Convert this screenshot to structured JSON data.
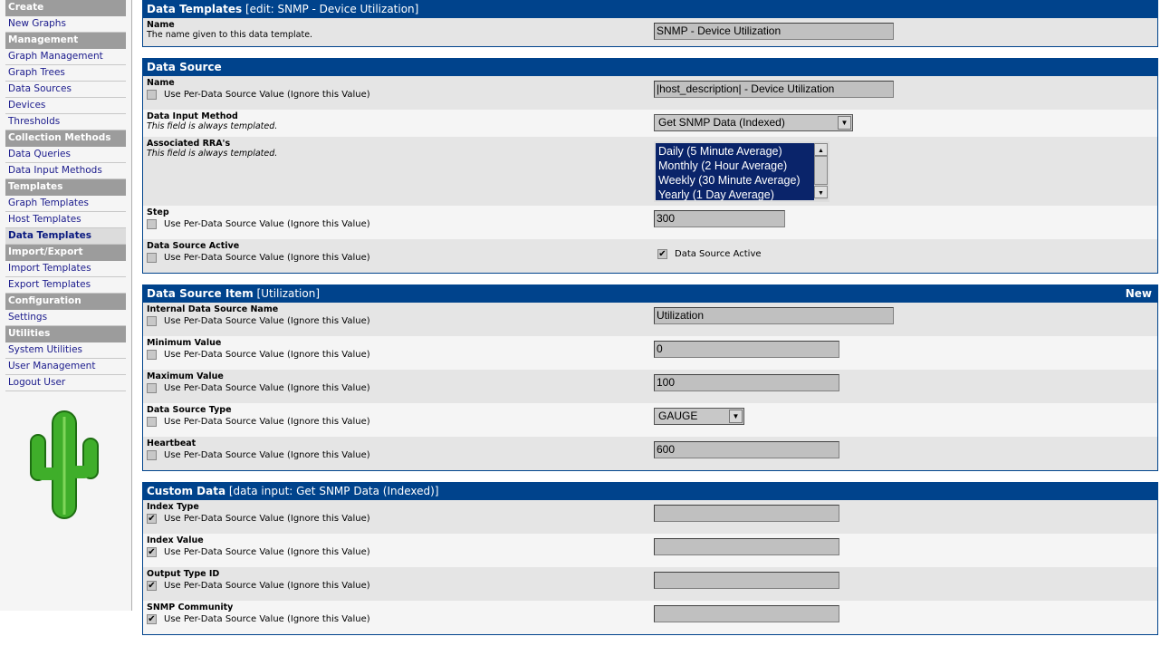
{
  "sidebar": {
    "items": [
      {
        "type": "header",
        "label": "Create"
      },
      {
        "type": "link",
        "label": "New Graphs"
      },
      {
        "type": "header",
        "label": "Management"
      },
      {
        "type": "link",
        "label": "Graph Management"
      },
      {
        "type": "link",
        "label": "Graph Trees"
      },
      {
        "type": "link",
        "label": "Data Sources"
      },
      {
        "type": "link",
        "label": "Devices"
      },
      {
        "type": "link",
        "label": "Thresholds"
      },
      {
        "type": "header",
        "label": "Collection Methods"
      },
      {
        "type": "link",
        "label": "Data Queries"
      },
      {
        "type": "link",
        "label": "Data Input Methods"
      },
      {
        "type": "header",
        "label": "Templates"
      },
      {
        "type": "link",
        "label": "Graph Templates"
      },
      {
        "type": "link",
        "label": "Host Templates"
      },
      {
        "type": "link",
        "label": "Data Templates",
        "selected": true
      },
      {
        "type": "header",
        "label": "Import/Export"
      },
      {
        "type": "link",
        "label": "Import Templates"
      },
      {
        "type": "link",
        "label": "Export Templates"
      },
      {
        "type": "header",
        "label": "Configuration"
      },
      {
        "type": "link",
        "label": "Settings"
      },
      {
        "type": "header",
        "label": "Utilities"
      },
      {
        "type": "link",
        "label": "System Utilities"
      },
      {
        "type": "link",
        "label": "User Management"
      },
      {
        "type": "link",
        "label": "Logout User"
      }
    ],
    "logo": "cactus-logo"
  },
  "colors": {
    "header": "#00438c",
    "row_dark": "#e5e5e5",
    "row_light": "#f5f5f5",
    "sidebar_header": "#9c9c9c",
    "link": "#1a1a8c"
  },
  "override_label": "Use Per-Data Source Value (Ignore this Value)",
  "panels": [
    {
      "title": "Data Templates",
      "subtitle": "[edit: SNMP - Device Utilization]",
      "rows": [
        {
          "label": "Name",
          "desc": "The name given to this data template.",
          "control": "text",
          "value": "SNMP - Device Utilization"
        }
      ]
    },
    {
      "title": "Data Source",
      "rows": [
        {
          "label": "Name",
          "override": false,
          "control": "text",
          "value": "|host_description| - Device Utilization"
        },
        {
          "label": "Data Input Method",
          "desc": "This field is always templated.",
          "italic": true,
          "control": "select",
          "value": "Get SNMP Data (Indexed)"
        },
        {
          "label": "Associated RRA's",
          "desc": "This field is always templated.",
          "italic": true,
          "control": "listbox",
          "options": [
            "Daily (5 Minute Average)",
            "Monthly (2 Hour Average)",
            "Weekly (30 Minute Average)",
            "Yearly (1 Day Average)"
          ]
        },
        {
          "label": "Step",
          "override": false,
          "control": "text",
          "value": "300"
        },
        {
          "label": "Data Source Active",
          "override": false,
          "control": "checkbox",
          "checked": true,
          "value": "Data Source Active"
        }
      ]
    },
    {
      "title": "Data Source Item",
      "subtitle": "[Utilization]",
      "action": "New",
      "rows": [
        {
          "label": "Internal Data Source Name",
          "override": false,
          "control": "text",
          "value": "Utilization"
        },
        {
          "label": "Minimum Value",
          "override": false,
          "control": "text",
          "value": "0"
        },
        {
          "label": "Maximum Value",
          "override": false,
          "control": "text",
          "value": "100"
        },
        {
          "label": "Data Source Type",
          "override": false,
          "control": "select",
          "value": "GAUGE"
        },
        {
          "label": "Heartbeat",
          "override": false,
          "control": "text",
          "value": "600"
        }
      ]
    },
    {
      "title": "Custom Data",
      "subtitle": "[data input: Get SNMP Data (Indexed)]",
      "rows": [
        {
          "label": "Index Type",
          "override": true,
          "control": "text",
          "value": ""
        },
        {
          "label": "Index Value",
          "override": true,
          "control": "text",
          "value": ""
        },
        {
          "label": "Output Type ID",
          "override": true,
          "control": "text",
          "value": ""
        },
        {
          "label": "SNMP Community",
          "override": true,
          "control": "text",
          "value": ""
        }
      ]
    }
  ]
}
